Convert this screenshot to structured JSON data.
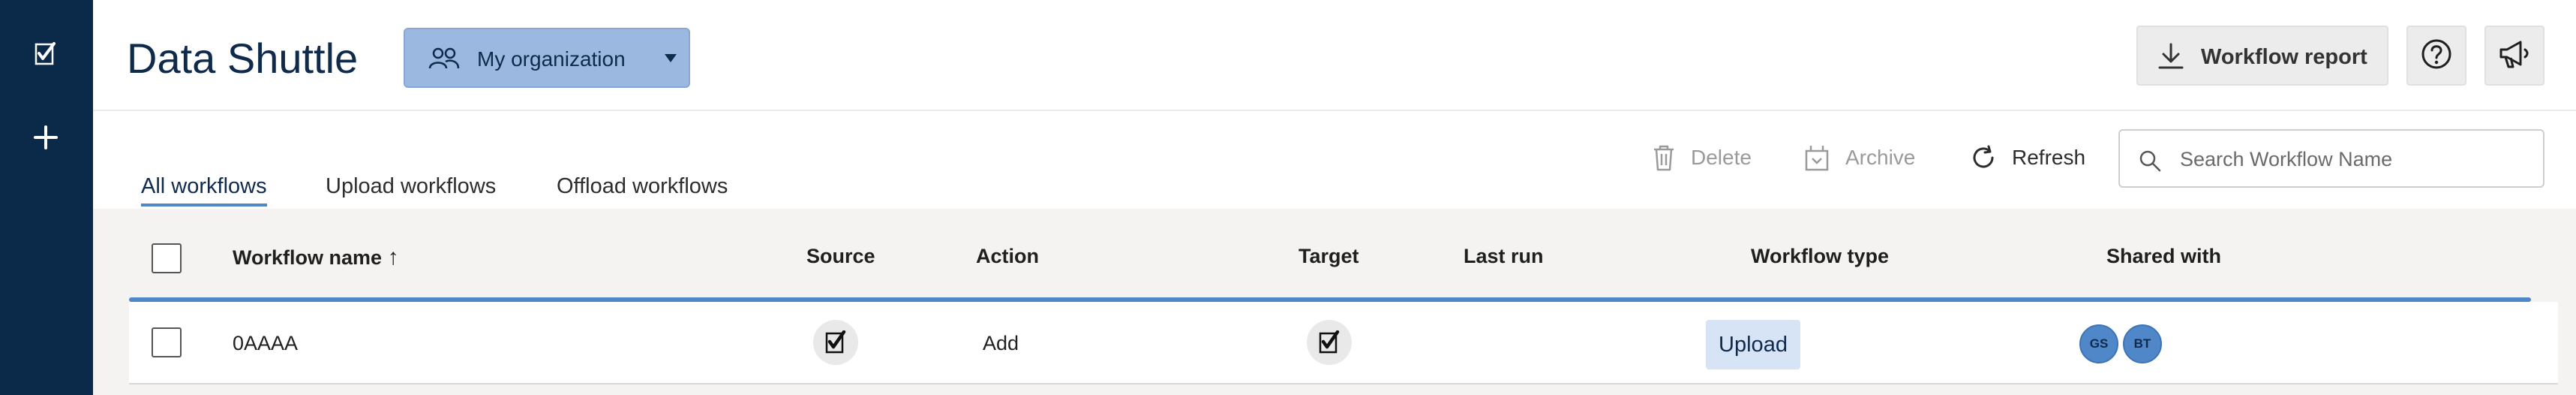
{
  "app": {
    "title": "Data Shuttle"
  },
  "header": {
    "org_label": "My organization",
    "report_label": "Workflow report"
  },
  "tabs": [
    {
      "label": "All workflows",
      "active": true
    },
    {
      "label": "Upload workflows",
      "active": false
    },
    {
      "label": "Offload workflows",
      "active": false
    }
  ],
  "toolbar": {
    "delete_label": "Delete",
    "archive_label": "Archive",
    "refresh_label": "Refresh",
    "search_placeholder": "Search Workflow Name"
  },
  "table": {
    "columns": {
      "name": "Workflow name",
      "source": "Source",
      "action": "Action",
      "target": "Target",
      "last_run": "Last run",
      "type": "Workflow type",
      "shared": "Shared with"
    },
    "sort_indicator": "↑",
    "rows": [
      {
        "name": "0AAAA",
        "source_icon": "smartsheet-icon",
        "action": "Add",
        "target_icon": "smartsheet-icon",
        "last_run": "",
        "type": "Upload",
        "shared": [
          "GS",
          "BT"
        ]
      }
    ]
  },
  "colors": {
    "sidebar": "#0b2a4a",
    "accent": "#4f87c9",
    "org_button": "#9bb8e0",
    "chip": "#d6e4f6"
  }
}
